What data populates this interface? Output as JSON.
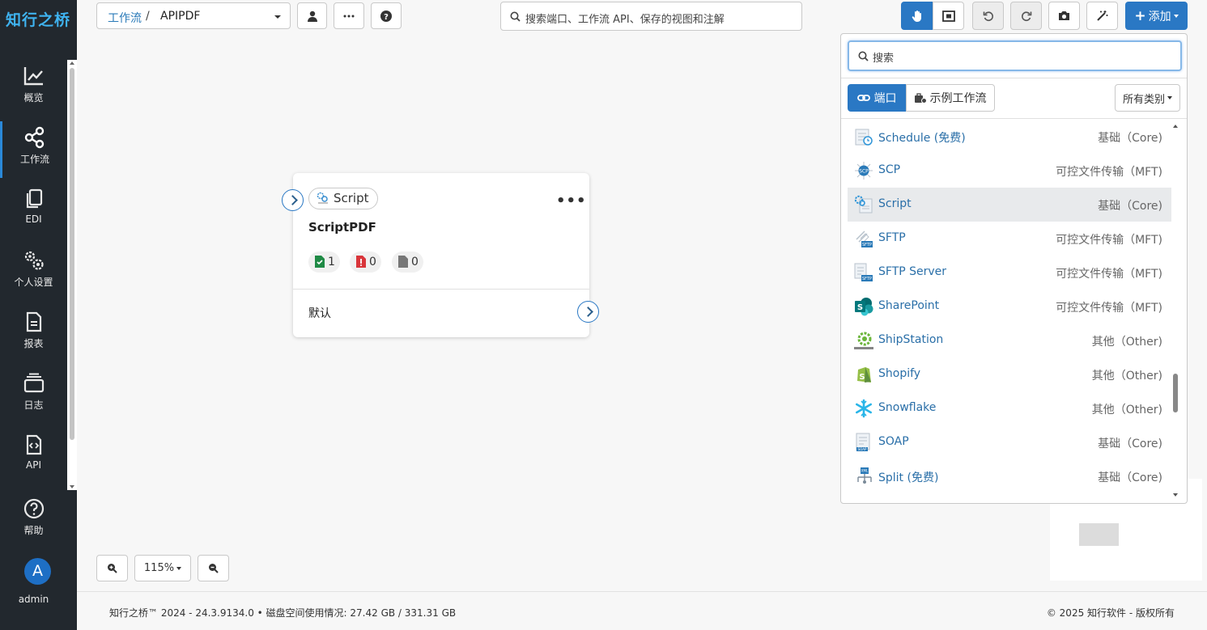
{
  "app": {
    "logo": "知行之桥"
  },
  "sidebar": {
    "items": [
      {
        "label": "概览",
        "icon": "chart-line-icon"
      },
      {
        "label": "工作流",
        "icon": "share-nodes-icon",
        "active": true
      },
      {
        "label": "EDI",
        "icon": "copy-icon"
      },
      {
        "label": "个人设置",
        "icon": "gears-icon"
      },
      {
        "label": "报表",
        "icon": "file-lines-icon"
      },
      {
        "label": "日志",
        "icon": "layers-icon"
      },
      {
        "label": "API",
        "icon": "file-code-icon"
      },
      {
        "label": "帮助",
        "icon": "circle-question-icon"
      }
    ],
    "user": {
      "initial": "A",
      "name": "admin"
    }
  },
  "header": {
    "breadcrumb": {
      "parent": "工作流",
      "separator": "/",
      "current": "APIPDF"
    },
    "search_placeholder": "搜索端口、工作流 API、保存的视图和注解",
    "add_label": "添加"
  },
  "node": {
    "type": "Script",
    "name": "ScriptPDF",
    "counts": {
      "success": "1",
      "error": "0",
      "pending": "0"
    },
    "output_label": "默认"
  },
  "panel": {
    "search_placeholder": "搜索",
    "tabs": {
      "ports": "端口",
      "examples": "示例工作流"
    },
    "category_dropdown": "所有类别",
    "items": [
      {
        "name": "Schedule (免费)",
        "category": "基础（Core)",
        "icon": "schedule-icon"
      },
      {
        "name": "SCP",
        "category": "可控文件传输（MFT)",
        "icon": "scp-icon"
      },
      {
        "name": "Script",
        "category": "基础（Core)",
        "icon": "script-icon",
        "selected": true
      },
      {
        "name": "SFTP",
        "category": "可控文件传输（MFT)",
        "icon": "sftp-icon"
      },
      {
        "name": "SFTP Server",
        "category": "可控文件传输（MFT)",
        "icon": "sftp-server-icon"
      },
      {
        "name": "SharePoint",
        "category": "可控文件传输（MFT)",
        "icon": "sharepoint-icon"
      },
      {
        "name": "ShipStation",
        "category": "其他（Other)",
        "icon": "shipstation-icon"
      },
      {
        "name": "Shopify",
        "category": "其他（Other)",
        "icon": "shopify-icon"
      },
      {
        "name": "Snowflake",
        "category": "其他（Other)",
        "icon": "snowflake-icon"
      },
      {
        "name": "SOAP",
        "category": "基础（Core)",
        "icon": "soap-icon"
      },
      {
        "name": "Split (免费)",
        "category": "基础（Core)",
        "icon": "split-icon"
      }
    ]
  },
  "zoom": {
    "level": "115%"
  },
  "footer": {
    "left": "知行之桥™ 2024 - 24.3.9134.0  •  磁盘空间使用情况:  27.42 GB / 331.31 GB",
    "right": "© 2025 知行软件 - 版权所有"
  },
  "colors": {
    "primary": "#2a78c4",
    "sidebar_bg": "#22282e",
    "link": "#2a6fa8"
  }
}
